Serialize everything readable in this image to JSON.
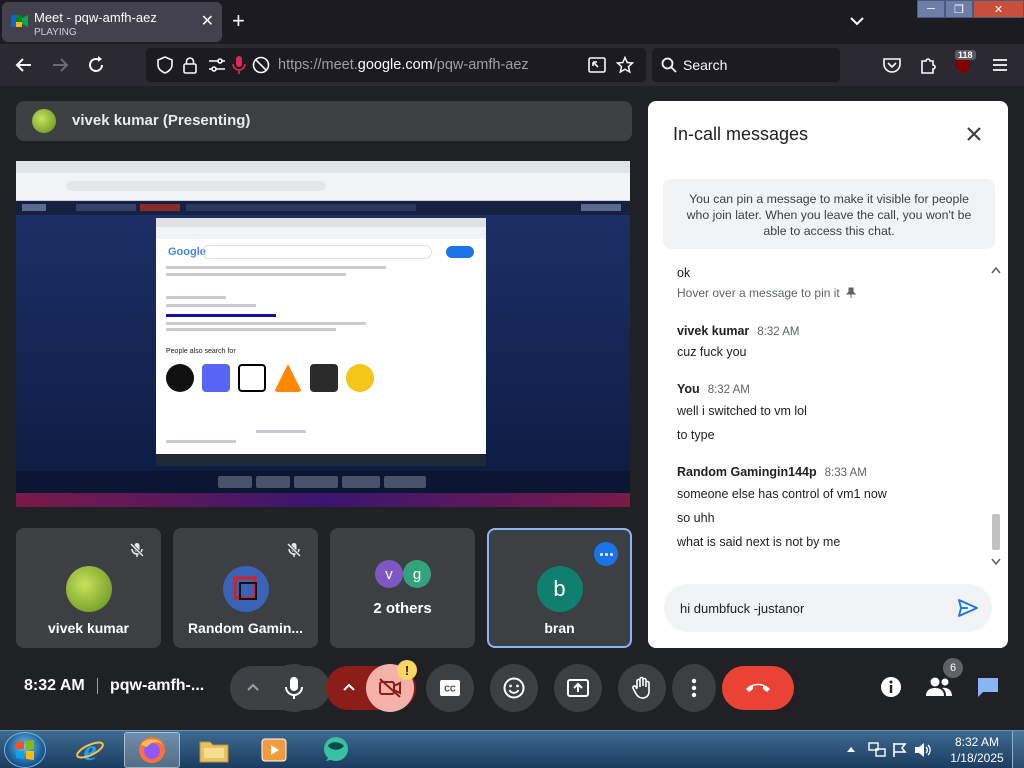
{
  "browser": {
    "tab": {
      "title": "Meet - pqw-amfh-aez",
      "subtitle": "PLAYING",
      "close_label": "✕"
    },
    "new_tab_label": "+",
    "url_prefix": "https://meet.",
    "url_domain": "google.com",
    "url_path": "/pqw-amfh-aez",
    "search_placeholder": "Search",
    "extension_badge": "118",
    "window_controls": {
      "minimize": "─",
      "maximize": "❐",
      "close": "✕"
    }
  },
  "meet": {
    "presenter_label": "vivek kumar (Presenting)",
    "shared_screen": {
      "inner_heading": "People also search for",
      "google_logo_text": "Google"
    },
    "tiles": [
      {
        "name": "vivek kumar",
        "muted": true
      },
      {
        "name": "Random Gamin...",
        "muted": true
      },
      {
        "name": "2 others",
        "avatars": [
          "v",
          "g"
        ]
      },
      {
        "name": "bran",
        "avatar": "b",
        "active": true
      }
    ],
    "chat": {
      "title": "In-call messages",
      "pin_note": "You can pin a message to make it visible for people who join later. When you leave the call, you won't be able to access this chat.",
      "messages": [
        {
          "text": "ok"
        },
        {
          "hint": "Hover over a message to pin it"
        },
        {
          "sender": "vivek kumar",
          "time": "8:32 AM"
        },
        {
          "text": "cuz fuck you"
        },
        {
          "sender": "You",
          "time": "8:32 AM"
        },
        {
          "text": "well i switched to vm lol"
        },
        {
          "text": "to type"
        },
        {
          "sender": "Random Gamingin144p",
          "time": "8:33 AM"
        },
        {
          "text": "someone else has control of vm1 now"
        },
        {
          "text": "so uhh"
        },
        {
          "text": "what is said next is not by me"
        }
      ],
      "input_value": "hi dumbfuck -justanor"
    },
    "controls": {
      "clock": "8:32 AM",
      "meeting_code": "pqw-amfh-...",
      "camera_warning": "!",
      "participant_count": "6"
    }
  },
  "taskbar": {
    "time": "8:32 AM",
    "date": "1/18/2025"
  },
  "colors": {
    "meet_bg": "#202124",
    "surface": "#3c4043",
    "hangup_red": "#ea4335",
    "accent_blue": "#1a73e8",
    "chat_bg": "#ffffff"
  }
}
